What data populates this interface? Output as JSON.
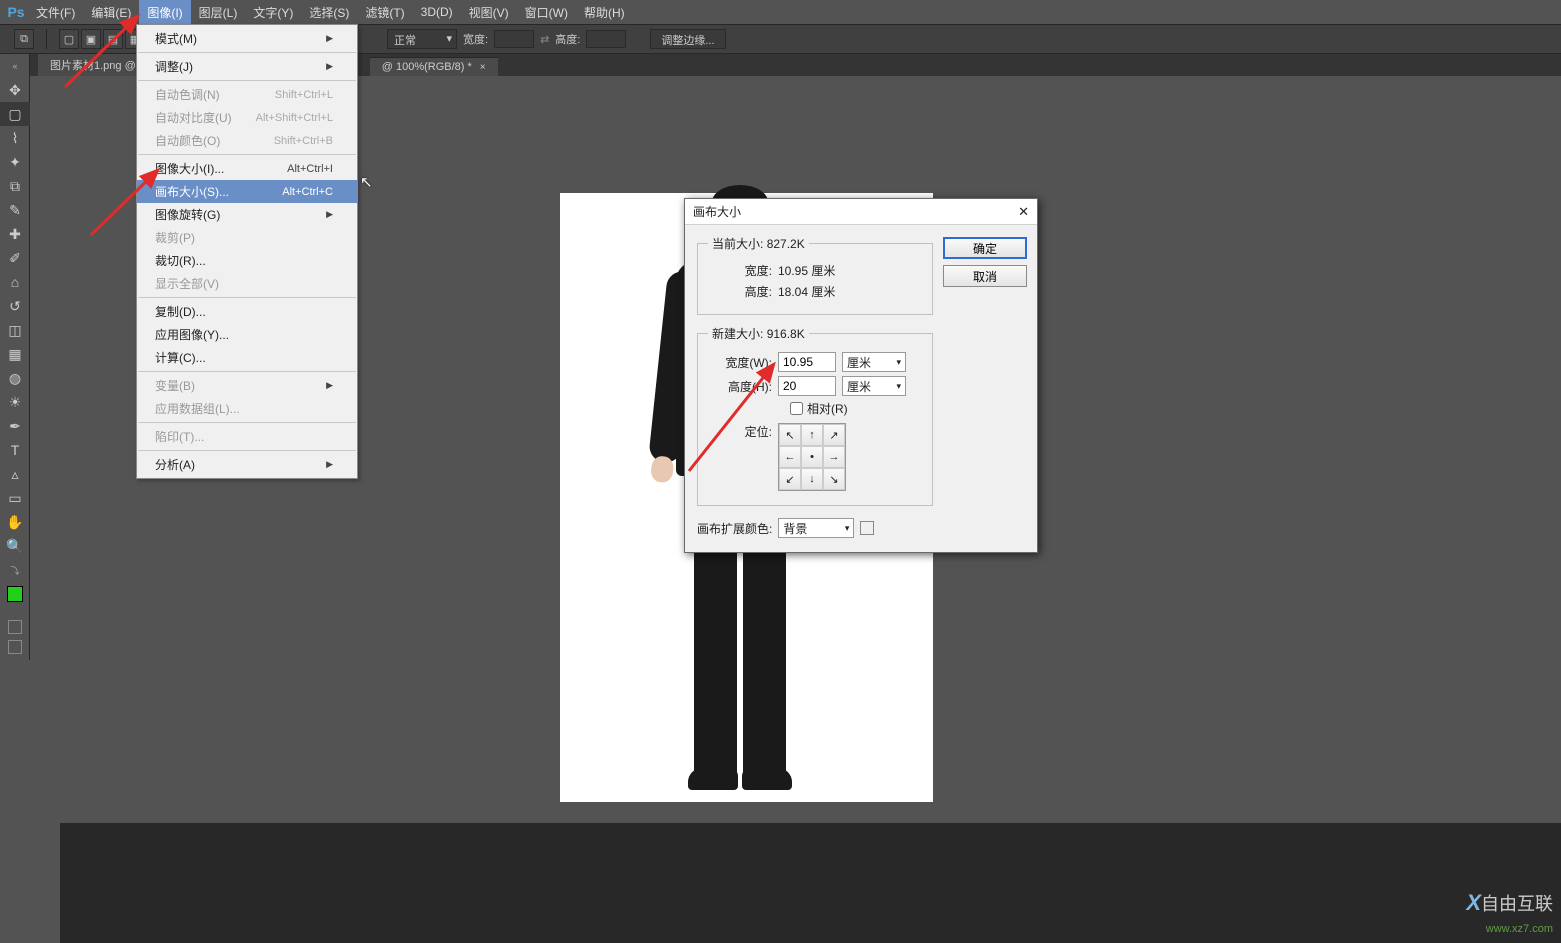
{
  "app": {
    "logo": "Ps"
  },
  "menu": {
    "file": "文件(F)",
    "edit": "编辑(E)",
    "image": "图像(I)",
    "layer": "图层(L)",
    "type": "文字(Y)",
    "select": "选择(S)",
    "filter": "滤镜(T)",
    "threeD": "3D(D)",
    "view": "视图(V)",
    "window": "窗口(W)",
    "help": "帮助(H)"
  },
  "options": {
    "mode": "正常",
    "width_lbl": "宽度:",
    "height_lbl": "高度:",
    "refine": "调整边缘..."
  },
  "tabs": {
    "t1": "图片素材1.png @",
    "t2": "@ 100%(RGB/8) *"
  },
  "image_menu": {
    "mode": "模式(M)",
    "adjust": "调整(J)",
    "auto_tone": "自动色调(N)",
    "auto_tone_sc": "Shift+Ctrl+L",
    "auto_contrast": "自动对比度(U)",
    "auto_contrast_sc": "Alt+Shift+Ctrl+L",
    "auto_color": "自动颜色(O)",
    "auto_color_sc": "Shift+Ctrl+B",
    "image_size": "图像大小(I)...",
    "image_size_sc": "Alt+Ctrl+I",
    "canvas_size": "画布大小(S)...",
    "canvas_size_sc": "Alt+Ctrl+C",
    "rotate": "图像旋转(G)",
    "crop": "裁剪(P)",
    "trim": "裁切(R)...",
    "reveal": "显示全部(V)",
    "duplicate": "复制(D)...",
    "apply_image": "应用图像(Y)...",
    "calc": "计算(C)...",
    "variables": "变量(B)",
    "apply_ds": "应用数据组(L)...",
    "trap": "陷印(T)...",
    "analysis": "分析(A)"
  },
  "dialog": {
    "title": "画布大小",
    "ok": "确定",
    "cancel": "取消",
    "current_legend": "当前大小:",
    "current_bytes": "827.2K",
    "cur_w_lbl": "宽度:",
    "cur_w_val": "10.95 厘米",
    "cur_h_lbl": "高度:",
    "cur_h_val": "18.04 厘米",
    "new_legend": "新建大小:",
    "new_bytes": "916.8K",
    "new_w_lbl": "宽度(W):",
    "new_w_val": "10.95",
    "new_h_lbl": "高度(H):",
    "new_h_val": "20",
    "unit": "厘米",
    "relative": "相对(R)",
    "anchor_lbl": "定位:",
    "ext_lbl": "画布扩展颜色:",
    "ext_val": "背景"
  },
  "watermark": {
    "line1": "自由互联",
    "line2": "www.xz7.com"
  },
  "arrows": {
    "a1": "↖",
    "a2": "↑",
    "a3": "↗",
    "a4": "←",
    "a5": "•",
    "a6": "→",
    "a7": "↙",
    "a8": "↓",
    "a9": "↘"
  }
}
